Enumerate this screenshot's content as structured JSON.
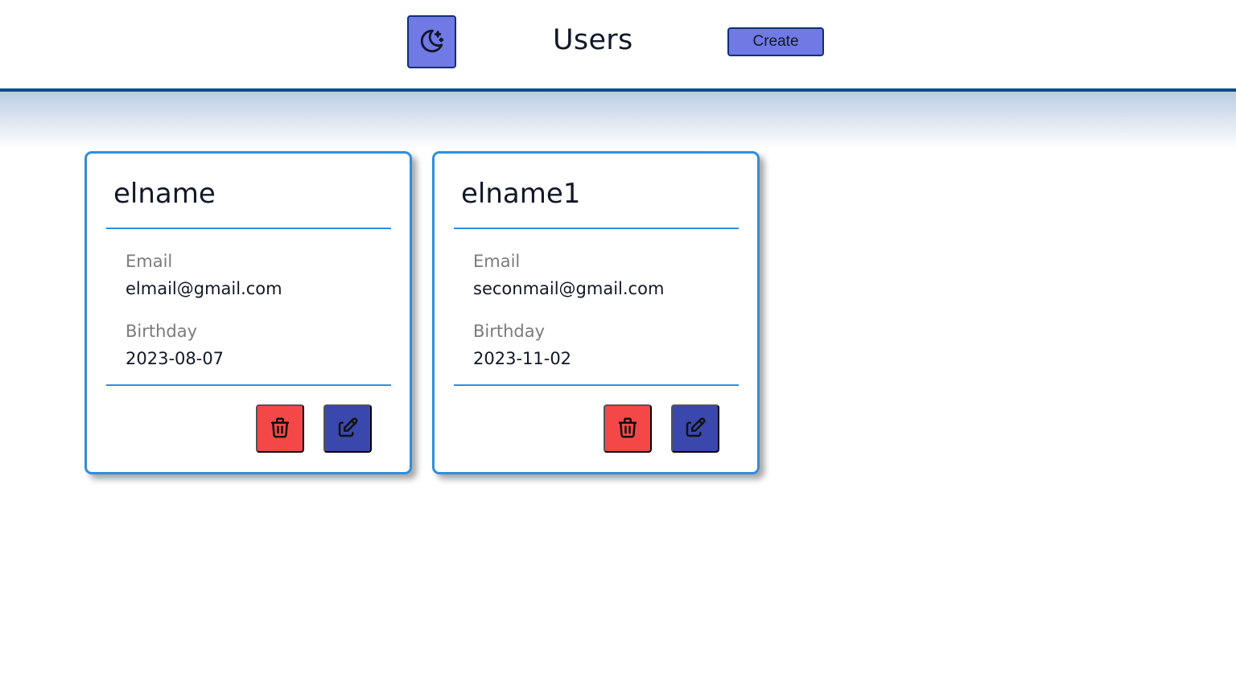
{
  "header": {
    "title": "Users",
    "create_label": "Create",
    "theme_toggle_icon": "moon-stars-icon",
    "accent_color": "#7079e4",
    "border_color": "#0b4a9a"
  },
  "users": [
    {
      "name": "elname",
      "email_label": "Email",
      "email": "elmail@gmail.com",
      "birthday_label": "Birthday",
      "birthday": "2023-08-07",
      "delete_icon": "trash-icon",
      "edit_icon": "edit-icon"
    },
    {
      "name": "elname1",
      "email_label": "Email",
      "email": "seconmail@gmail.com",
      "birthday_label": "Birthday",
      "birthday": "2023-11-02",
      "delete_icon": "trash-icon",
      "edit_icon": "edit-icon"
    }
  ],
  "colors": {
    "card_border": "#2f8ee0",
    "delete": "#f44848",
    "edit": "#3a47ac",
    "label_text": "#7b7b7b"
  }
}
